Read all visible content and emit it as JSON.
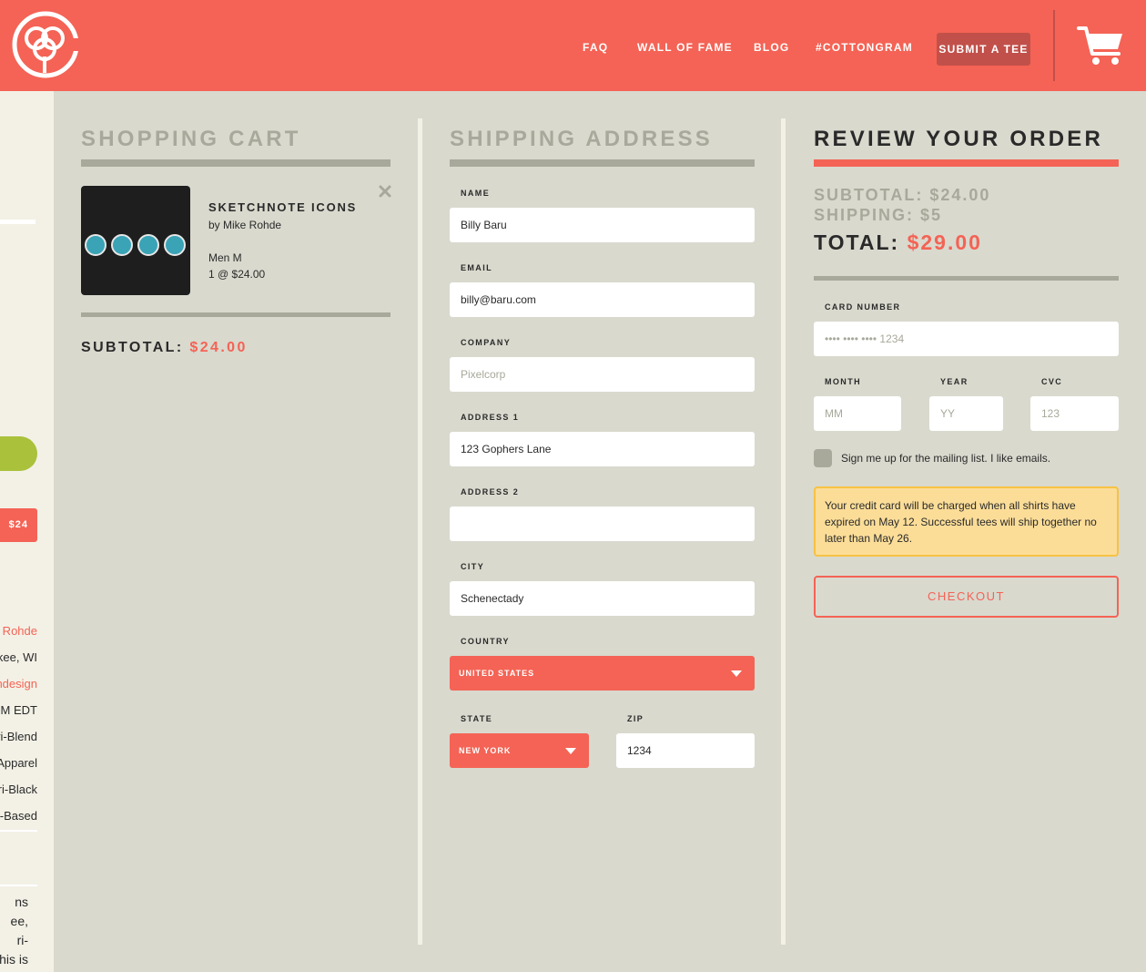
{
  "header": {
    "nav": [
      {
        "label": "FAQ"
      },
      {
        "label": "WALL OF FAME"
      },
      {
        "label": "BLOG"
      },
      {
        "label": "#COTTONGRAM"
      }
    ],
    "submit_label": "SUBMIT A TEE",
    "brand_color": "#f46355"
  },
  "left_panel": {
    "price_badge": "$24",
    "rows": [
      "e Rohde",
      "kee, WI",
      "ndesign",
      "PM EDT",
      "ri-Blend",
      "Apparel",
      "ri-Black",
      "r-Based"
    ],
    "description": [
      "ns",
      "ee,",
      "ri-",
      "his is"
    ]
  },
  "cart": {
    "title": "SHOPPING CART",
    "item": {
      "name": "SKETCHNOTE ICONS",
      "author": "by Mike Rohde",
      "size": "Men M",
      "qty_price": "1 @ $24.00"
    },
    "subtotal_label": "SUBTOTAL:",
    "subtotal_value": "$24.00"
  },
  "shipping": {
    "title": "SHIPPING ADDRESS",
    "name_label": "NAME",
    "name_value": "Billy Baru",
    "email_label": "EMAIL",
    "email_value": "billy@baru.com",
    "company_label": "COMPANY",
    "company_placeholder": "Pixelcorp",
    "address1_label": "ADDRESS 1",
    "address1_value": "123 Gophers Lane",
    "address2_label": "ADDRESS 2",
    "address2_value": "",
    "city_label": "CITY",
    "city_value": "Schenectady",
    "country_label": "COUNTRY",
    "country_value": "UNITED STATES",
    "state_label": "STATE",
    "state_value": "NEW YORK",
    "zip_label": "ZIP",
    "zip_value": "1234"
  },
  "review": {
    "title": "REVIEW YOUR ORDER",
    "subtotal": "SUBTOTAL: $24.00",
    "shipping": "SHIPPING: $5",
    "total_label": "TOTAL:",
    "total_value": "$29.00",
    "card_label": "CARD NUMBER",
    "card_placeholder": "•••• •••• •••• 1234",
    "month_label": "MONTH",
    "month_placeholder": "MM",
    "year_label": "YEAR",
    "year_placeholder": "YY",
    "cvc_label": "CVC",
    "cvc_placeholder": "123",
    "mailing_label": "Sign me up for the mailing list. I like emails.",
    "notice": "Your credit card will be charged when all shirts have expired on May 12. Successful tees will ship together no later than May 26.",
    "checkout_label": "CHECKOUT"
  }
}
